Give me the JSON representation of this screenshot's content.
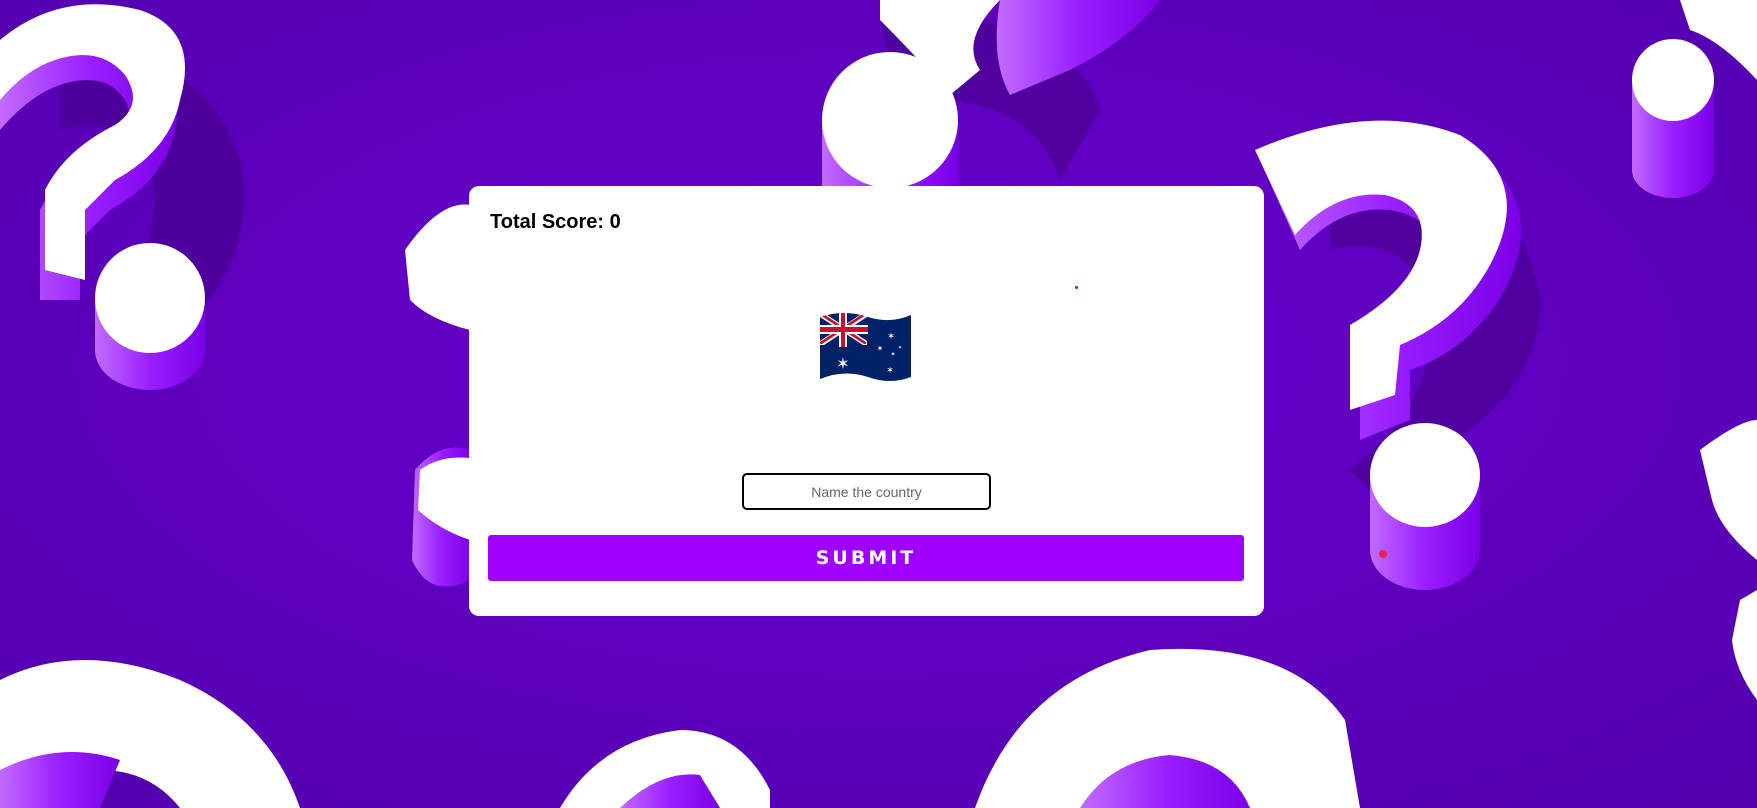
{
  "game": {
    "score_label": "Total Score: 0",
    "flag_icon": "australia-flag-icon",
    "answer_placeholder": "Name the country",
    "answer_value": "",
    "submit_label": "SUBMIT"
  },
  "colors": {
    "background": "#5f00c2",
    "accent": "#a000ff",
    "card": "#ffffff"
  }
}
